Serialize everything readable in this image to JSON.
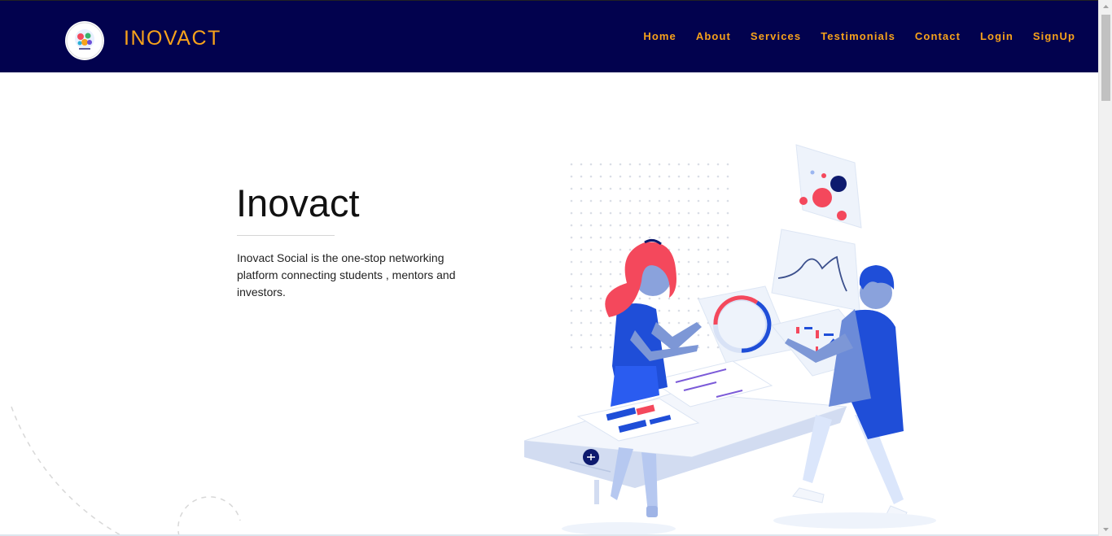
{
  "brand": {
    "name": "INOVACT",
    "logo_icon": "inovact-logo-icon"
  },
  "nav": {
    "items": [
      {
        "label": "Home"
      },
      {
        "label": "About"
      },
      {
        "label": "Services"
      },
      {
        "label": "Testimonials"
      },
      {
        "label": "Contact"
      },
      {
        "label": "Login"
      },
      {
        "label": "SignUp"
      }
    ]
  },
  "hero": {
    "title": "Inovact",
    "description": "Inovact Social is the one-stop networking platform connecting students , mentors and investors."
  },
  "colors": {
    "navbar_bg": "#02024e",
    "accent": "#f7a21b",
    "illustration_blue": "#1f4ed8",
    "illustration_red": "#f4485c"
  }
}
